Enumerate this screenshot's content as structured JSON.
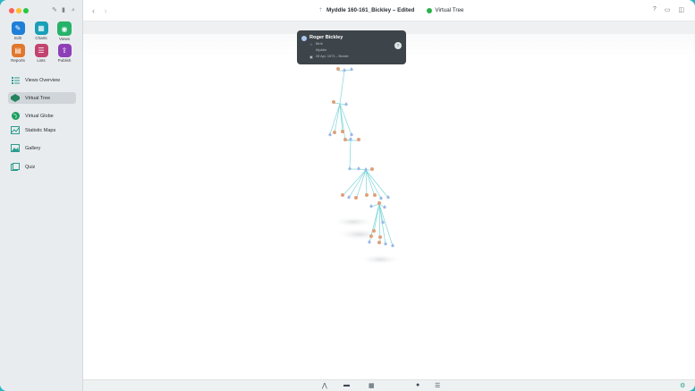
{
  "window": {
    "document_title": "Myddle 160-161_Bickley – Edited",
    "mode_label": "Virtual Tree"
  },
  "sidebar": {
    "top_buttons": [
      {
        "label": "Edit",
        "icon": "pencil-icon",
        "color": "#1f7fd8"
      },
      {
        "label": "Charts",
        "icon": "charts-icon",
        "color": "#1a9fb8"
      },
      {
        "label": "Views",
        "icon": "eye-icon",
        "color": "#27b26a"
      },
      {
        "label": "Reports",
        "icon": "reports-icon",
        "color": "#e0772c"
      },
      {
        "label": "Lists",
        "icon": "lists-icon",
        "color": "#c2436f"
      },
      {
        "label": "Publish",
        "icon": "publish-icon",
        "color": "#8e3fb8"
      }
    ],
    "items": [
      {
        "label": "Views Overview",
        "icon": "views-overview-icon"
      },
      {
        "label": "Virtual Tree",
        "icon": "virtual-tree-icon"
      },
      {
        "label": "Virtual Globe",
        "icon": "globe-icon"
      },
      {
        "label": "Statistic Maps",
        "icon": "statistic-maps-icon"
      },
      {
        "label": "Gallery",
        "icon": "gallery-icon"
      },
      {
        "label": "Quiz",
        "icon": "quiz-icon"
      }
    ]
  },
  "tooltip": {
    "name": "Roger  Bickley",
    "line1": "Birth",
    "line2": "Myddle",
    "line3": "28 Apr. 1573 – Bickler"
  },
  "colors": {
    "accent": "#2cb6c8",
    "male_node": "#9bb7e6",
    "female_node": "#e0a07a",
    "edge": "#7fd6d9"
  }
}
